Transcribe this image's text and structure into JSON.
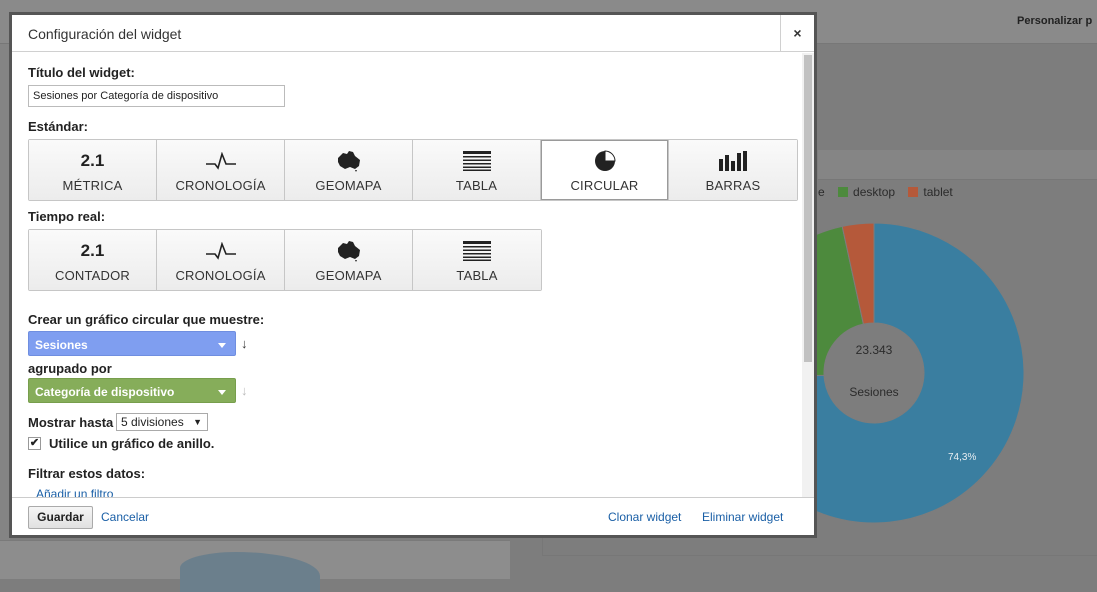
{
  "background": {
    "personalize_label": "Personalizar p",
    "legend": [
      {
        "label": "e",
        "color": ""
      },
      {
        "label": "desktop",
        "color": "#4d8a3d"
      },
      {
        "label": "tablet",
        "color": "#b5593a"
      }
    ],
    "donut": {
      "total": "23.343",
      "metric": "Sesiones",
      "percent_label": "74,3%",
      "segments": [
        {
          "name": "mobile",
          "value": 74.3,
          "color": "#3a7ea0"
        },
        {
          "name": "desktop",
          "value": 22.3,
          "color": "#4d8a3d"
        },
        {
          "name": "tablet",
          "value": 3.4,
          "color": "#b5593a"
        }
      ]
    }
  },
  "modal": {
    "title": "Configuración del widget",
    "close_label": "×",
    "widget_title_label": "Título del widget:",
    "widget_title_value": "Sesiones por Categoría de dispositivo",
    "standard_label": "Estándar:",
    "standard_types": [
      {
        "icon": "2.1",
        "label": "MÉTRICA"
      },
      {
        "icon": "timeline",
        "label": "CRONOLOGÍA"
      },
      {
        "icon": "map",
        "label": "GEOMAPA"
      },
      {
        "icon": "table",
        "label": "TABLA"
      },
      {
        "icon": "pie",
        "label": "CIRCULAR"
      },
      {
        "icon": "bars",
        "label": "BARRAS"
      }
    ],
    "realtime_label": "Tiempo real:",
    "realtime_types": [
      {
        "icon": "2.1",
        "label": "CONTADOR"
      },
      {
        "icon": "timeline",
        "label": "CRONOLOGÍA"
      },
      {
        "icon": "map",
        "label": "GEOMAPA"
      },
      {
        "icon": "table",
        "label": "TABLA"
      }
    ],
    "pie_prompt": "Crear un gráfico circular que muestre:",
    "metric_select": "Sesiones",
    "grouped_by_label": "agrupado por",
    "dimension_select": "Categoría de dispositivo",
    "show_up_to_label": "Mostrar hasta",
    "divisions_select": "5 divisiones",
    "donut_checkbox_label": "Utilice un gráfico de anillo.",
    "donut_checkbox_checked": "✔",
    "filter_label": "Filtrar estos datos:",
    "add_filter_link": "Añadir un filtro",
    "footer": {
      "save": "Guardar",
      "cancel": "Cancelar",
      "clone": "Clonar widget",
      "delete": "Eliminar widget"
    }
  }
}
